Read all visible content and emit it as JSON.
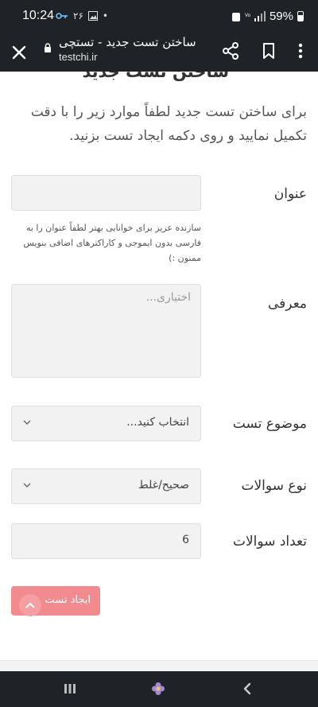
{
  "status_bar": {
    "time": "10:24",
    "left_icons": [
      "key-icon",
      "۲۶",
      "image-icon",
      "•"
    ],
    "battery": "59%"
  },
  "browser": {
    "title": "ساختن تست جدید - تستچی",
    "url": "testchi.ir"
  },
  "page": {
    "heading": "ساختن تست جدید",
    "intro": "برای ساختن تست جدید لطفاً موارد زیر را با دقت تکمیل نمایید و روی دکمه ایجاد تست بزنید."
  },
  "form": {
    "title_label": "عنوان",
    "title_value": "",
    "title_hint": "سازنده عزیز برای خوانایی بهتر لطفاً عنوان را به فارسی بدون ایموجی و کاراکترهای اضافی بنویس ممنون :)",
    "intro_label": "معرفی",
    "intro_placeholder": "اختیاری...",
    "topic_label": "موضوع تست",
    "topic_value": "انتخاب کنید...",
    "qtype_label": "نوع سوالات",
    "qtype_value": "صحیح/غلط",
    "qcount_label": "تعداد سوالات",
    "qcount_value": "6",
    "submit_label": "ایجاد تست"
  },
  "colors": {
    "chrome": "#1f2327",
    "button": "#f28b8f",
    "field_bg": "#f2f2f2"
  }
}
